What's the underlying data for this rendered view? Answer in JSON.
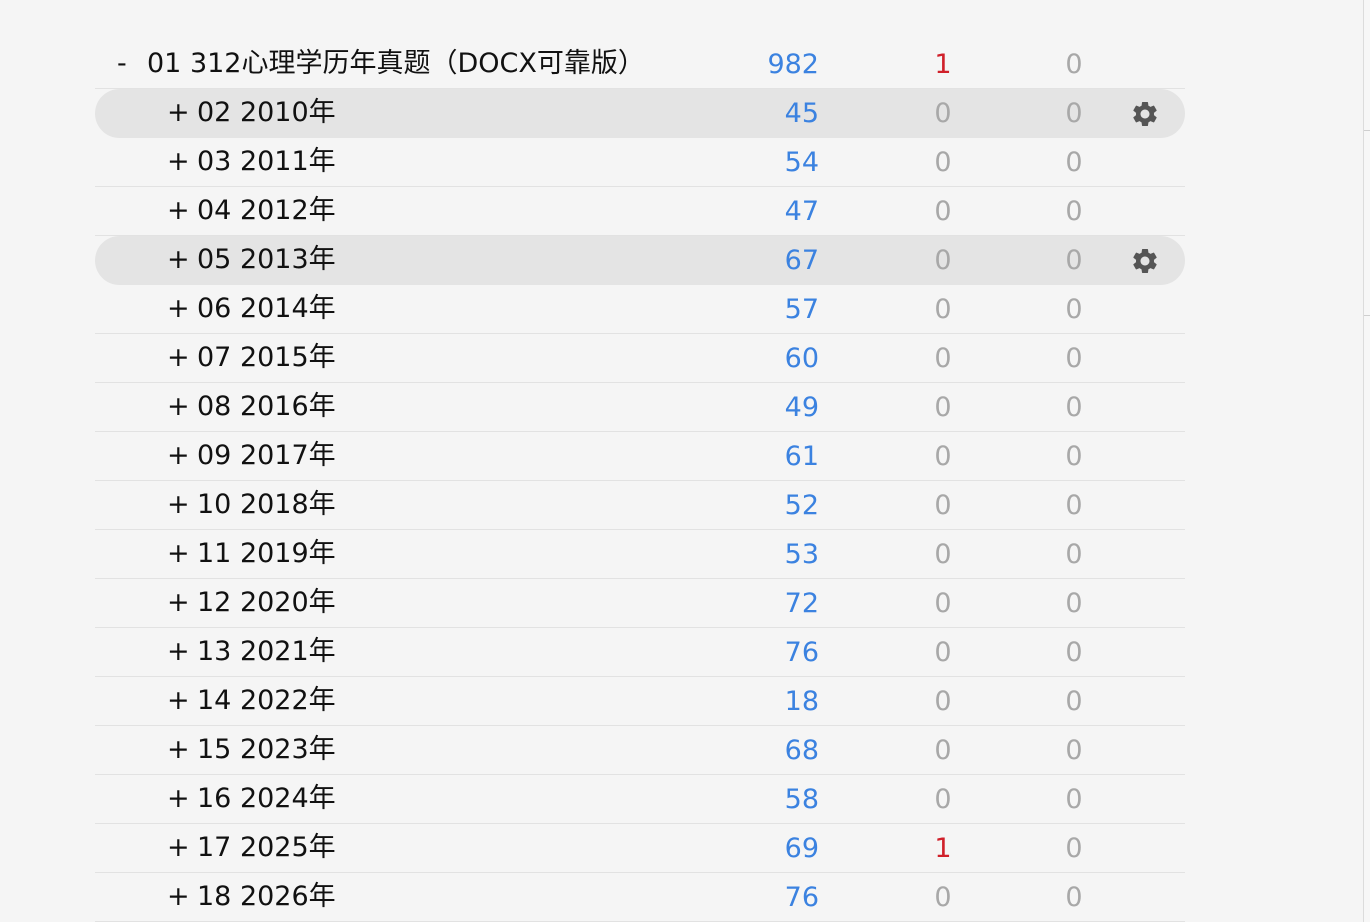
{
  "colors": {
    "new": "#3b82e0",
    "learn_active": "#d0202a",
    "zero": "#a8a8a8",
    "highlight_row": "#e4e4e4"
  },
  "decks": [
    {
      "toggle": "-",
      "name": "01 312心理学历年真题（DOCX可靠版）",
      "new": "982",
      "learn": "1",
      "due": "0",
      "level": 0,
      "gear": false,
      "highlight": false
    },
    {
      "toggle": "+",
      "name": "02 2010年",
      "new": "45",
      "learn": "0",
      "due": "0",
      "level": 1,
      "gear": true,
      "gear_icon": "gear-icon",
      "highlight": true
    },
    {
      "toggle": "+",
      "name": "03 2011年",
      "new": "54",
      "learn": "0",
      "due": "0",
      "level": 1,
      "gear": false,
      "highlight": false
    },
    {
      "toggle": "+",
      "name": "04 2012年",
      "new": "47",
      "learn": "0",
      "due": "0",
      "level": 1,
      "gear": false,
      "highlight": false
    },
    {
      "toggle": "+",
      "name": "05 2013年",
      "new": "67",
      "learn": "0",
      "due": "0",
      "level": 1,
      "gear": true,
      "gear_icon": "gear-icon",
      "highlight": true
    },
    {
      "toggle": "+",
      "name": "06 2014年",
      "new": "57",
      "learn": "0",
      "due": "0",
      "level": 1,
      "gear": false,
      "highlight": false
    },
    {
      "toggle": "+",
      "name": "07 2015年",
      "new": "60",
      "learn": "0",
      "due": "0",
      "level": 1,
      "gear": false,
      "highlight": false
    },
    {
      "toggle": "+",
      "name": "08 2016年",
      "new": "49",
      "learn": "0",
      "due": "0",
      "level": 1,
      "gear": false,
      "highlight": false
    },
    {
      "toggle": "+",
      "name": "09 2017年",
      "new": "61",
      "learn": "0",
      "due": "0",
      "level": 1,
      "gear": false,
      "highlight": false
    },
    {
      "toggle": "+",
      "name": "10 2018年",
      "new": "52",
      "learn": "0",
      "due": "0",
      "level": 1,
      "gear": false,
      "highlight": false
    },
    {
      "toggle": "+",
      "name": "11 2019年",
      "new": "53",
      "learn": "0",
      "due": "0",
      "level": 1,
      "gear": false,
      "highlight": false
    },
    {
      "toggle": "+",
      "name": "12 2020年",
      "new": "72",
      "learn": "0",
      "due": "0",
      "level": 1,
      "gear": false,
      "highlight": false
    },
    {
      "toggle": "+",
      "name": "13 2021年",
      "new": "76",
      "learn": "0",
      "due": "0",
      "level": 1,
      "gear": false,
      "highlight": false
    },
    {
      "toggle": "+",
      "name": "14 2022年",
      "new": "18",
      "learn": "0",
      "due": "0",
      "level": 1,
      "gear": false,
      "highlight": false
    },
    {
      "toggle": "+",
      "name": "15 2023年",
      "new": "68",
      "learn": "0",
      "due": "0",
      "level": 1,
      "gear": false,
      "highlight": false
    },
    {
      "toggle": "+",
      "name": "16 2024年",
      "new": "58",
      "learn": "0",
      "due": "0",
      "level": 1,
      "gear": false,
      "highlight": false
    },
    {
      "toggle": "+",
      "name": "17 2025年",
      "new": "69",
      "learn": "1",
      "due": "0",
      "level": 1,
      "gear": false,
      "highlight": false
    },
    {
      "toggle": "+",
      "name": "18 2026年",
      "new": "76",
      "learn": "0",
      "due": "0",
      "level": 1,
      "gear": false,
      "highlight": false
    }
  ]
}
